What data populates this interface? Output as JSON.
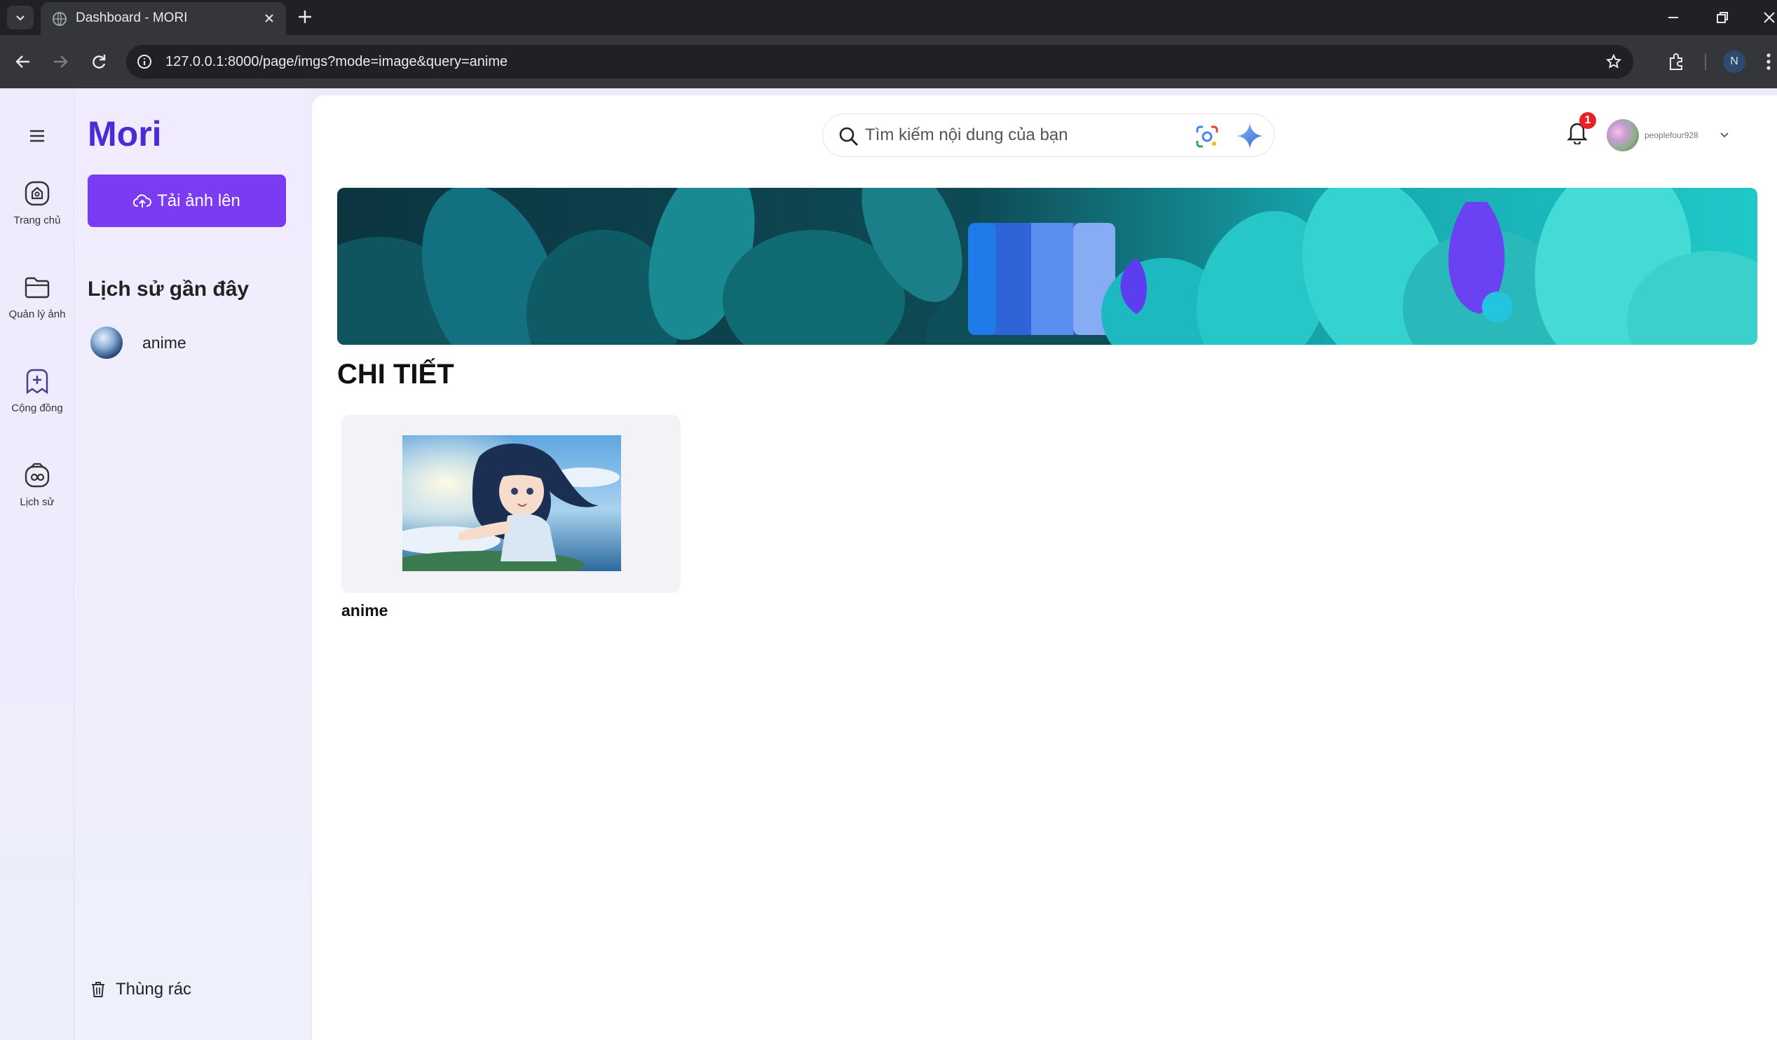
{
  "browser": {
    "tab_title": "Dashboard - MORI",
    "url": "127.0.0.1:8000/page/imgs?mode=image&query=anime",
    "profile_initial": "N"
  },
  "app": {
    "logo": "Mori",
    "upload_label": "Tải ảnh lên",
    "rail": [
      {
        "label": "Trang chủ",
        "icon": "home-icon"
      },
      {
        "label": "Quản lý ảnh",
        "icon": "folder-icon"
      },
      {
        "label": "Cộng đồng",
        "icon": "community-icon"
      },
      {
        "label": "Lịch sử",
        "icon": "history-icon"
      }
    ],
    "recent_title": "Lịch sử gần đây",
    "recent_items": [
      {
        "label": "anime"
      }
    ],
    "trash_label": "Thùng rác"
  },
  "header": {
    "search_placeholder": "Tìm kiếm nội dung của bạn",
    "notification_count": "1",
    "username": "peoplefour928"
  },
  "main": {
    "section_title": "CHI TIẾT",
    "results": [
      {
        "label": "anime"
      }
    ]
  },
  "colors": {
    "brand": "#4b2bd6",
    "button": "#7a3bf2",
    "badge": "#e8202a"
  }
}
